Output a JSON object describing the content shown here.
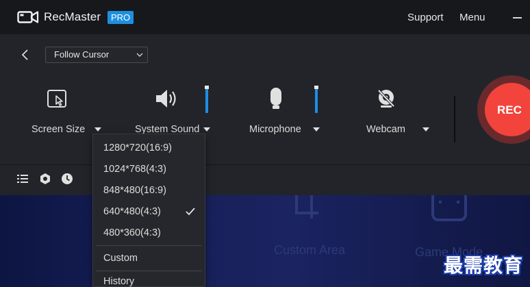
{
  "app": {
    "name": "RecMaster",
    "badge": "PRO",
    "icon": "camera-icon"
  },
  "header": {
    "support_label": "Support",
    "menu_label": "Menu",
    "minimize_icon": "minimize-icon"
  },
  "mode": {
    "back_icon": "chevron-left-icon",
    "selected": "Follow Cursor"
  },
  "controls": {
    "screen_size": {
      "label": "Screen Size",
      "icon": "screen-size-icon"
    },
    "system_sound": {
      "label": "System Sound",
      "icon": "speaker-icon",
      "volume": 1.0
    },
    "microphone": {
      "label": "Microphone",
      "icon": "microphone-icon",
      "volume": 1.0
    },
    "webcam": {
      "label": "Webcam",
      "icon": "webcam-off-icon"
    }
  },
  "rec": {
    "label": "REC"
  },
  "toolbar": {
    "icons": [
      "list-icon",
      "settings-icon",
      "clock-icon"
    ]
  },
  "preview": {
    "captions": [
      "Custom Area",
      "Game Mode"
    ]
  },
  "dropdown": {
    "resolutions": [
      "1280*720(16:9)",
      "1024*768(4:3)",
      "848*480(16:9)",
      "640*480(4:3)",
      "480*360(4:3)"
    ],
    "selected": "640*480(4:3)",
    "custom_label": "Custom",
    "history_label": "History"
  },
  "watermark": {
    "text": "最需教育"
  },
  "colors": {
    "accent": "#1e8fe0",
    "rec": "#f2443c",
    "background": "#232429"
  }
}
